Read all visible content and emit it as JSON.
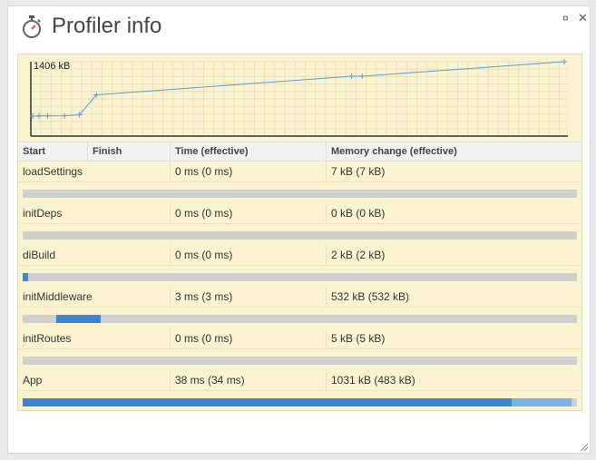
{
  "window": {
    "title": "Profiler info",
    "pin_symbol": "¤",
    "close_symbol": "✕"
  },
  "chart_data": {
    "type": "line",
    "ymax_label": "1406 kB",
    "ymax": 1406,
    "x": [
      0,
      3,
      7,
      15,
      22,
      30,
      150,
      155,
      250
    ],
    "y": [
      0,
      7,
      7,
      9,
      35,
      550,
      1030,
      1031,
      1406
    ],
    "grid": true,
    "color": "#5b9bd5"
  },
  "table": {
    "headers": {
      "start": "Start",
      "finish": "Finish",
      "time": "Time (effective)",
      "memory": "Memory change (effective)"
    },
    "rows": [
      {
        "name": "loadSettings",
        "time": "0 ms (0 ms)",
        "memory": "7 kB (7 kB)",
        "bar": []
      },
      {
        "name": "initDeps",
        "time": "0 ms (0 ms)",
        "memory": "0 kB (0 kB)",
        "bar": []
      },
      {
        "name": "diBuild",
        "time": "0 ms (0 ms)",
        "memory": "2 kB (2 kB)",
        "bar": [
          {
            "start": 0.0,
            "width": 0.01,
            "color": "#3d85d8"
          }
        ]
      },
      {
        "name": "initMiddleware",
        "time": "3 ms (3 ms)",
        "memory": "532 kB (532 kB)",
        "bar": [
          {
            "start": 0.06,
            "width": 0.08,
            "color": "#3d85d8"
          }
        ]
      },
      {
        "name": "initRoutes",
        "time": "0 ms (0 ms)",
        "memory": "5 kB (5 kB)",
        "bar": []
      },
      {
        "name": "App",
        "time": "38 ms (34 ms)",
        "memory": "1031 kB (483 kB)",
        "bar": [
          {
            "start": 0.0,
            "width": 0.882,
            "color": "#3d85d8"
          },
          {
            "start": 0.882,
            "width": 0.108,
            "color": "#7ab4e8"
          }
        ]
      }
    ]
  }
}
